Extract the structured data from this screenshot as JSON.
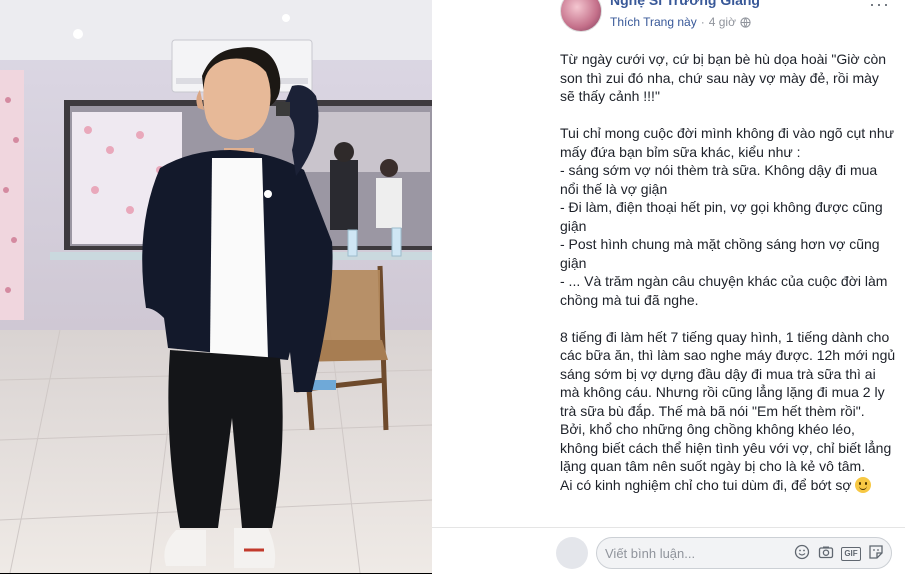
{
  "post": {
    "author": "Nghệ Sĩ Trường Giang",
    "like_page": "Thích Trang này",
    "time": "4 giờ",
    "more": "···",
    "paragraphs": [
      "Từ ngày cưới vợ, cứ bị bạn bè hù dọa hoài \"Giờ còn son thì zui đó nha, chứ sau này vợ mày đẻ, rồi mày sẽ thấy cảnh !!!\"",
      "",
      "Tui chỉ mong cuộc đời mình không đi vào ngõ cụt như mấy đứa bạn bỉm sữa khác, kiểu như :",
      "- sáng sớm vợ nói thèm trà sữa. Không dậy đi mua nổi thế là vợ giận",
      "- Đi làm, điện thoại hết pin, vợ gọi không được cũng giận",
      "- Post hình chung mà mặt chồng sáng hơn vợ cũng giận",
      "- ... Và trăm ngàn câu chuyện khác của cuộc đời làm chồng mà tui đã nghe.",
      "",
      "8 tiếng đi làm hết 7 tiếng quay hình, 1 tiếng dành cho các bữa ăn, thì làm sao nghe máy được. 12h mới ngủ sáng sớm bị vợ dựng đầu dậy đi mua trà sữa thì ai mà không cáu. Nhưng rồi cũng lẳng lặng đi mua 2 ly trà sữa bù đắp. Thế mà bã nói \"Em hết thèm rồi\".",
      "Bởi, khổ cho những ông chồng không khéo léo, không biết cách thể hiện tình yêu với vợ, chỉ biết lẳng lặng quan tâm nên suốt ngày bị cho là kẻ vô tâm.",
      "Ai có kinh nghiệm chỉ cho tui dùm đi, để bớt sợ"
    ],
    "emoji": "smile-emoji"
  },
  "comment": {
    "placeholder": "Viết bình luận...",
    "icons": [
      "emoji-icon",
      "camera-icon",
      "gif-icon",
      "sticker-icon"
    ],
    "gif_label": "GIF"
  },
  "colors": {
    "link": "#385898",
    "meta": "#90949c",
    "text": "#1d2129"
  }
}
